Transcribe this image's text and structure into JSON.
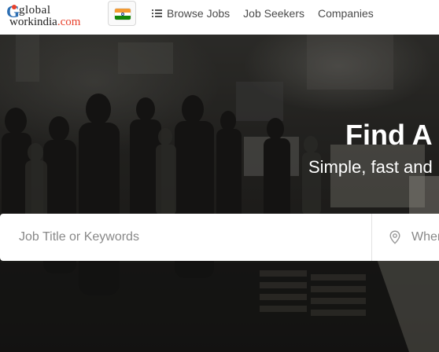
{
  "header": {
    "logo": {
      "word1": "global",
      "word2_main": "workindia",
      "word2_suffix": ".com"
    },
    "country_flag": "india-flag-icon",
    "nav": [
      {
        "label": "Browse Jobs",
        "icon": "list-icon"
      },
      {
        "label": "Job Seekers"
      },
      {
        "label": "Companies"
      }
    ]
  },
  "hero": {
    "title": "Find A",
    "subtitle": "Simple, fast and",
    "search": {
      "keywords_placeholder": "Job Title or Keywords",
      "location_placeholder": "Where",
      "location_icon": "map-pin-icon"
    }
  },
  "colors": {
    "brand_blue": "#2d6fb3",
    "brand_red": "#e8412c",
    "nav_text": "#4a4a4a",
    "hero_text": "#ffffff",
    "placeholder": "#888888"
  }
}
